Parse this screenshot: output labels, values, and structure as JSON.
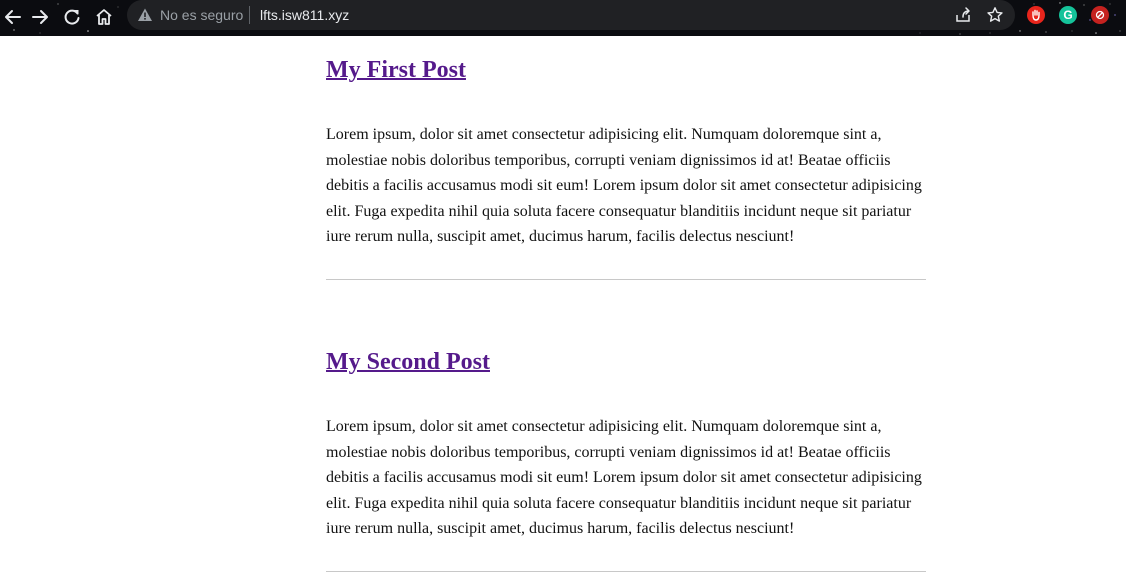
{
  "browser": {
    "security_status": "No es seguro",
    "url": "lfts.isw811.xyz",
    "icons": {
      "back": "back-arrow-icon",
      "forward": "forward-arrow-icon",
      "reload": "reload-icon",
      "home": "home-icon",
      "security": "warning-triangle-icon",
      "share": "share-icon",
      "bookmark": "star-icon"
    },
    "extensions": [
      {
        "name": "adblock-extension-icon",
        "color": "#e8251c"
      },
      {
        "name": "grammarly-extension-icon",
        "color": "#15c39a",
        "glyph": "G"
      },
      {
        "name": "red-extension-icon",
        "color": "#c5221f"
      }
    ]
  },
  "posts": [
    {
      "title": "My First Post",
      "body": "Lorem ipsum, dolor sit amet consectetur adipisicing elit. Numquam doloremque sint a, molestiae nobis doloribus temporibus, corrupti veniam dignissimos id at! Beatae officiis debitis a facilis accusamus modi sit eum! Lorem ipsum dolor sit amet consectetur adipisicing elit. Fuga expedita nihil quia soluta facere consequatur blanditiis incidunt neque sit pariatur iure rerum nulla, suscipit amet, ducimus harum, facilis delectus nesciunt!"
    },
    {
      "title": "My Second Post",
      "body": "Lorem ipsum, dolor sit amet consectetur adipisicing elit. Numquam doloremque sint a, molestiae nobis doloribus temporibus, corrupti veniam dignissimos id at! Beatae officiis debitis a facilis accusamus modi sit eum! Lorem ipsum dolor sit amet consectetur adipisicing elit. Fuga expedita nihil quia soluta facere consequatur blanditiis incidunt neque sit pariatur iure rerum nulla, suscipit amet, ducimus harum, facilis delectus nesciunt!"
    }
  ],
  "colors": {
    "toolbar_bg": "#0b0c10",
    "omnibox_bg": "#202124",
    "link_visited": "#551a8b",
    "rule": "#c8c8c8"
  }
}
